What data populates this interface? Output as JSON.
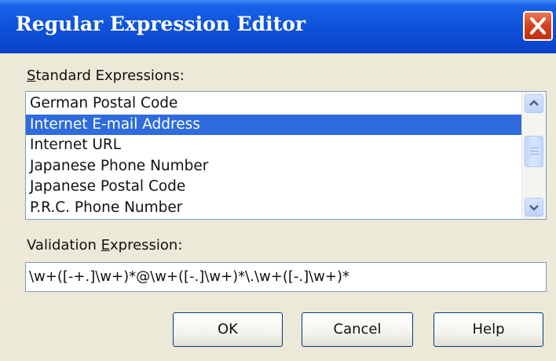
{
  "dialog": {
    "title": "Regular Expression Editor"
  },
  "standard_expressions": {
    "label_accel": "S",
    "label_rest": "tandard Expressions:",
    "items": [
      {
        "label": "German Postal Code",
        "selected": false
      },
      {
        "label": "Internet E-mail Address",
        "selected": true
      },
      {
        "label": "Internet URL",
        "selected": false
      },
      {
        "label": "Japanese Phone Number",
        "selected": false
      },
      {
        "label": "Japanese Postal Code",
        "selected": false
      },
      {
        "label": "P.R.C. Phone Number",
        "selected": false
      }
    ]
  },
  "validation_expression": {
    "label_before": "Validation ",
    "label_accel": "E",
    "label_after": "xpression:",
    "value": "\\w+([-+.]\\w+)*@\\w+([-.]\\w+)*\\.\\w+([-.]\\w+)*"
  },
  "buttons": {
    "ok": "OK",
    "cancel": "Cancel",
    "help": "Help"
  },
  "icons": {
    "close": "close-icon",
    "scroll_up": "chevron-up-icon",
    "scroll_down": "chevron-down-icon"
  },
  "colors": {
    "titlebar": "#0a48cf",
    "selection": "#2f6bdc",
    "close_button": "#d3401f",
    "dialog_background": "#ece9d8"
  }
}
